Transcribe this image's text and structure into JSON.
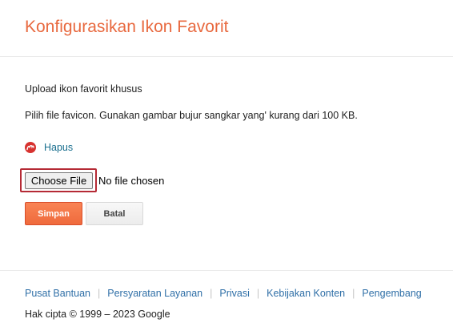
{
  "header": {
    "title": "Konfigurasikan Ikon Favorit"
  },
  "form": {
    "upload_heading": "Upload ikon favorit khusus",
    "upload_description": "Pilih file favicon. Gunakan gambar bujur sangkar yang' kurang dari 100 KB.",
    "remove_label": "Hapus",
    "choose_file_label": "Choose File",
    "file_status": "No file chosen",
    "save_label": "Simpan",
    "cancel_label": "Batal"
  },
  "footer": {
    "links": [
      {
        "label": "Pusat Bantuan"
      },
      {
        "label": "Persyaratan Layanan"
      },
      {
        "label": "Privasi"
      },
      {
        "label": "Kebijakan Konten"
      },
      {
        "label": "Pengembang"
      }
    ],
    "separator": "|",
    "copyright": "Hak cipta © 1999 – 2023 Google"
  },
  "icons": {
    "favicon_preview": "favicon-preview-icon"
  },
  "colors": {
    "accent": "#e8693f",
    "save_button": "#f5794a",
    "link": "#2f6fa7",
    "remove_link": "#1a6f8f",
    "focus_outline": "#b52a35",
    "favicon": "#d7322f"
  }
}
